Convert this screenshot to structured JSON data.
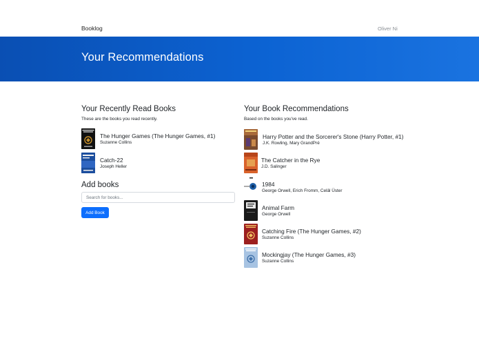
{
  "navbar": {
    "brand": "Booklog",
    "user": "Oliver Ni"
  },
  "hero": {
    "title": "Your Recommendations"
  },
  "recent": {
    "title": "Your Recently Read Books",
    "subtitle": "These are the books you read recently.",
    "books": [
      {
        "title": "The Hunger Games (The Hunger Games, #1)",
        "author": "Suzanne Collins",
        "cover_color": "#111111",
        "cover_text": "THE HUNGER GAMES"
      },
      {
        "title": "Catch-22",
        "author": "Joseph Heller",
        "cover_color": "#1c4e9e",
        "cover_text": "CATCH-22"
      }
    ]
  },
  "add": {
    "title": "Add books",
    "search_placeholder": "Search for books...",
    "button_label": "Add Book"
  },
  "recommendations": {
    "title": "Your Book Recommendations",
    "subtitle": "Based on the books you've read.",
    "books": [
      {
        "title": "Harry Potter and the Sorcerer's Stone (Harry Potter, #1)",
        "author": "J.K. Rowling, Mary GrandPré",
        "cover_color": "#8a5a3a"
      },
      {
        "title": "The Catcher in the Rye",
        "author": "J.D. Salinger",
        "cover_color": "#d9622b"
      },
      {
        "title": "1984",
        "author": "George Orwell, Erich Fromm, Celâl Üster",
        "cover_color": "#f4f6fa"
      },
      {
        "title": "Animal Farm",
        "author": "George Orwell",
        "cover_color": "#1a1a1a"
      },
      {
        "title": "Catching Fire (The Hunger Games, #2)",
        "author": "Suzanne Collins",
        "cover_color": "#9c1f1f"
      },
      {
        "title": "Mockingjay (The Hunger Games, #3)",
        "author": "Suzanne Collins",
        "cover_color": "#a7c3e2"
      }
    ]
  }
}
